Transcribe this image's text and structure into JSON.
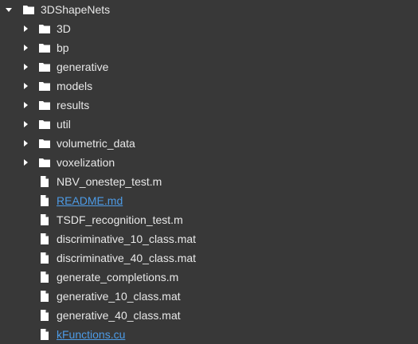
{
  "root": {
    "name": "3DShapeNets",
    "icon": "folder-icon",
    "expanded": true,
    "caret_icon": "chevron-down-icon"
  },
  "folders": [
    {
      "name": "3D",
      "icon": "folder-icon",
      "caret_icon": "chevron-right-icon"
    },
    {
      "name": "bp",
      "icon": "folder-icon",
      "caret_icon": "chevron-right-icon"
    },
    {
      "name": "generative",
      "icon": "folder-icon",
      "caret_icon": "chevron-right-icon"
    },
    {
      "name": "models",
      "icon": "folder-icon",
      "caret_icon": "chevron-right-icon"
    },
    {
      "name": "results",
      "icon": "folder-icon",
      "caret_icon": "chevron-right-icon"
    },
    {
      "name": "util",
      "icon": "folder-icon",
      "caret_icon": "chevron-right-icon"
    },
    {
      "name": "volumetric_data",
      "icon": "folder-icon",
      "caret_icon": "chevron-right-icon"
    },
    {
      "name": "voxelization",
      "icon": "folder-icon",
      "caret_icon": "chevron-right-icon"
    }
  ],
  "files": [
    {
      "name": "NBV_onestep_test.m",
      "icon": "file-icon",
      "link": false
    },
    {
      "name": "README.md",
      "icon": "file-icon",
      "link": true
    },
    {
      "name": "TSDF_recognition_test.m",
      "icon": "file-icon",
      "link": false
    },
    {
      "name": "discriminative_10_class.mat",
      "icon": "file-icon",
      "link": false
    },
    {
      "name": "discriminative_40_class.mat",
      "icon": "file-icon",
      "link": false
    },
    {
      "name": "generate_completions.m",
      "icon": "file-icon",
      "link": false
    },
    {
      "name": "generative_10_class.mat",
      "icon": "file-icon",
      "link": false
    },
    {
      "name": "generative_40_class.mat",
      "icon": "file-icon",
      "link": false
    },
    {
      "name": "kFunctions.cu",
      "icon": "file-icon",
      "link": true
    }
  ],
  "colors": {
    "background": "#383838",
    "text": "#e8e8e8",
    "icon": "#ffffff",
    "link": "#4d9be6"
  }
}
